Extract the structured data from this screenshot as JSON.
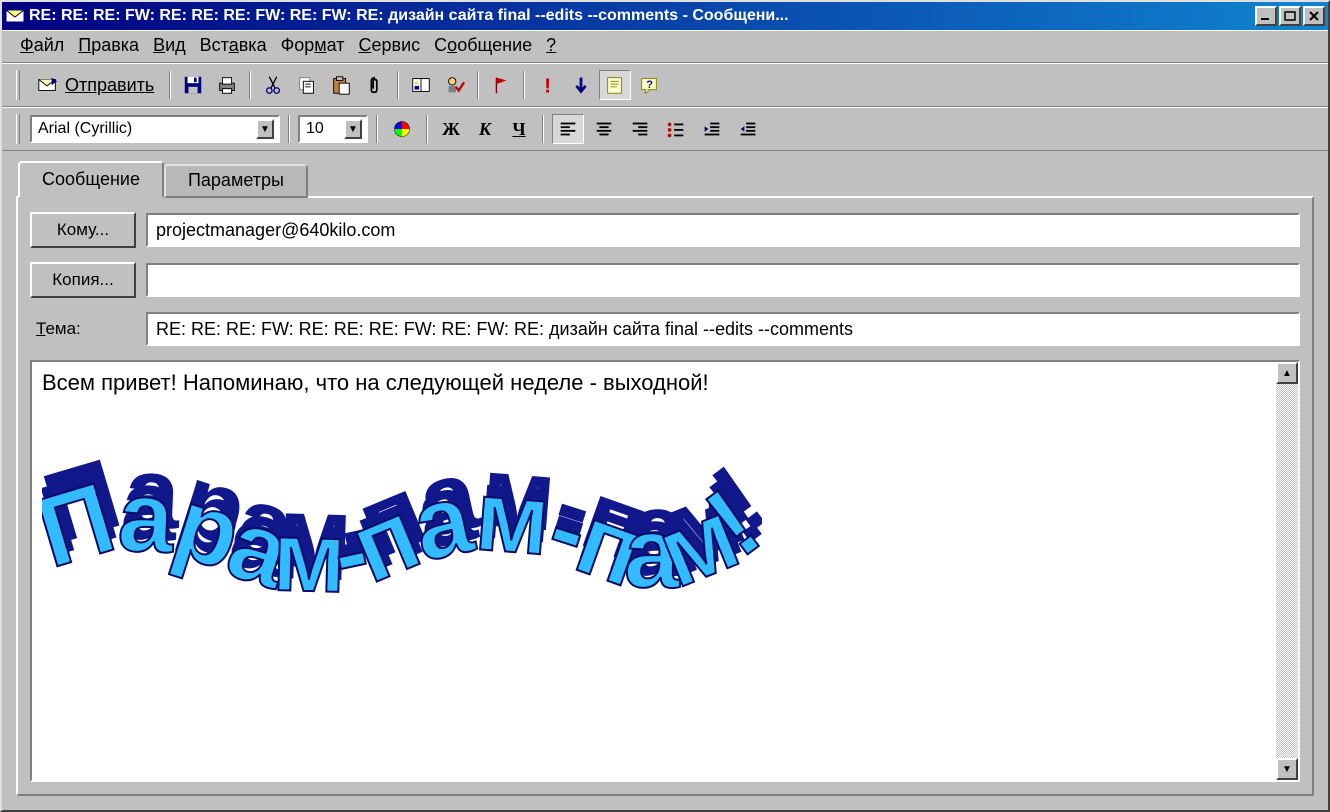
{
  "window": {
    "title": "RE: RE: RE: FW: RE: RE: RE: FW: RE: FW: RE: дизайн сайта final --edits --comments - Сообщени..."
  },
  "menu": {
    "file": "Файл",
    "edit": "Правка",
    "view": "Вид",
    "insert": "Вставка",
    "format": "Формат",
    "service": "Сервис",
    "message": "Сообщение",
    "help": "?"
  },
  "toolbar": {
    "send": "Отправить"
  },
  "format": {
    "font_name": "Arial (Cyrillic)",
    "font_size": "10",
    "bold": "Ж",
    "italic": "К",
    "underline": "Ч"
  },
  "tabs": {
    "message": "Сообщение",
    "params": "Параметры"
  },
  "fields": {
    "to_label": "Кому...",
    "to_value": "projectmanager@640kilo.com",
    "cc_label": "Копия...",
    "cc_value": "",
    "subject_label": "Тема:",
    "subject_value": "RE: RE: RE: FW: RE: RE: RE: FW: RE: FW: RE: дизайн сайта final --edits --comments"
  },
  "body": {
    "line1": "Всем привет! Напоминаю, что на следующей неделе - выходной!",
    "wordart": "Парам-пам-пам!"
  }
}
